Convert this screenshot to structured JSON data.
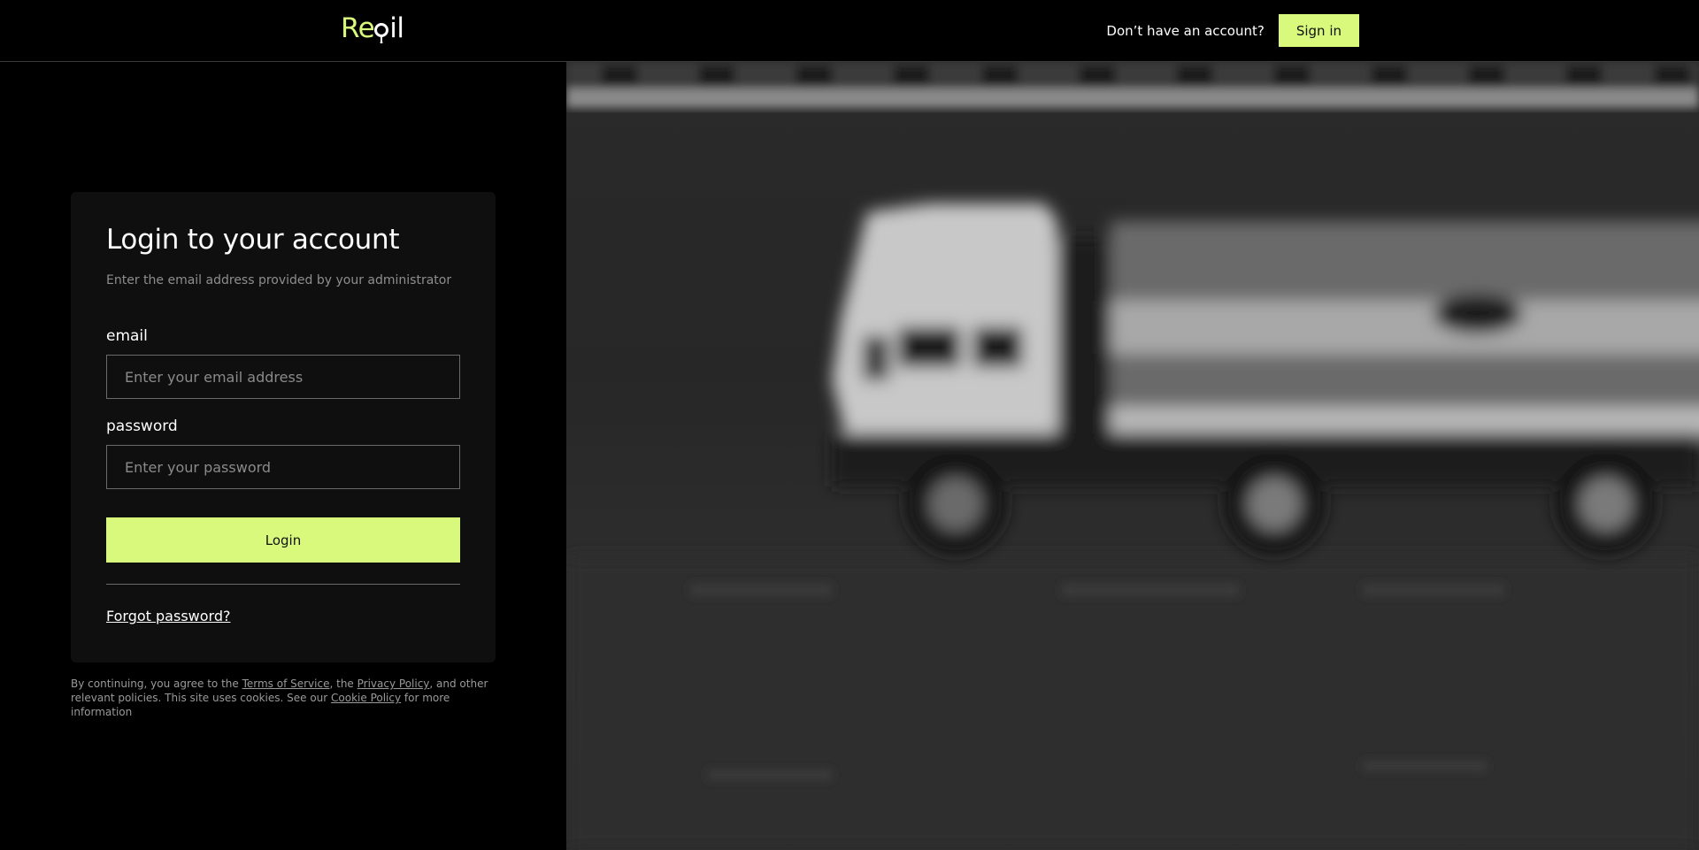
{
  "header": {
    "logo": {
      "part1": "Re",
      "part2": "il"
    },
    "no_account_text": "Don’t have an account?",
    "signin_label": "Sign in"
  },
  "login": {
    "title": "Login to your account",
    "subtitle": "Enter the email address provided by your administrator",
    "email_label": "email",
    "email_placeholder": "Enter your email address",
    "password_label": "password",
    "password_placeholder": "Enter your password",
    "login_label": "Login",
    "forgot_label": "Forgot password?"
  },
  "legal": {
    "prefix": "By continuing, you agree to the ",
    "terms": "Terms of Service",
    "mid1": ", the ",
    "privacy": "Privacy Policy",
    "mid2": ", and other relevant policies. This site uses cookies. See our ",
    "cookie": "Cookie Policy",
    "suffix": " for more information"
  },
  "colors": {
    "accent": "#d9f97c",
    "background": "#000000",
    "card": "#0f0f0f"
  },
  "icons": {
    "logo_drop": "oil-drop-icon"
  }
}
